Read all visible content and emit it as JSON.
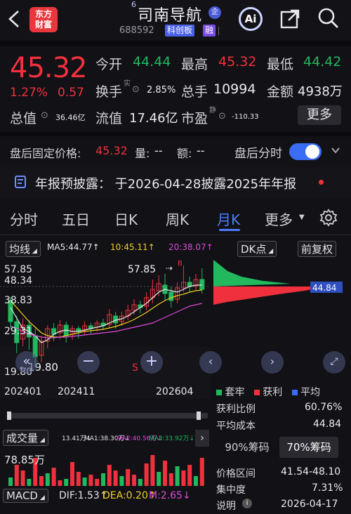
{
  "header": {
    "logo_line1": "东方",
    "logo_line2": "财富",
    "superscript": "6",
    "stock_name": "司南导航",
    "name_badge": "企",
    "stock_code": "688592",
    "tag_board": "科创板",
    "tag_margin": "融",
    "ai_label": "Ai"
  },
  "quote": {
    "price": "45.32",
    "change_pct": "1.27%",
    "change_abs": "0.57",
    "open_label": "今开",
    "open": "44.44",
    "high_label": "最高",
    "high": "45.32",
    "low_label": "最低",
    "low": "44.42",
    "turnover_label": "换手",
    "turnover_sup": "实",
    "turnover": "2.85%",
    "volume_label": "总手",
    "volume": "10994",
    "amount_label": "金额",
    "amount": "4938万",
    "mcap_label": "总值",
    "mcap": "36.46亿",
    "float_label": "流值",
    "float": "17.46亿",
    "pe_label": "市盈",
    "pe_sup": "静",
    "pe": "-110.33",
    "more_label": "更多"
  },
  "after_hours": {
    "price_label": "盘后固定价格:",
    "price": "45.32",
    "vol_label": "量:",
    "vol": "--",
    "amt_label": "额:",
    "amt": "--",
    "tick_label": "盘后分时"
  },
  "announcement": {
    "text": "年报预披露： 于2026-04-28披露2025年年报"
  },
  "tabs": [
    "分时",
    "五日",
    "日K",
    "周K",
    "月K",
    "更多"
  ],
  "chart_controls": {
    "ma_selector": "均线",
    "ma5": "MA5:44.77↑",
    "ma10": "10:45.11↑",
    "ma20": "20:38.07↑",
    "dk_label": "DK点",
    "adjust_label": "前复权"
  },
  "kline": {
    "y_ticks": [
      "57.85",
      "48.34",
      "38.83",
      "29.31",
      "19.80"
    ],
    "max_label": "57.85",
    "min_label": "19.80",
    "x_ticks": [
      "202401",
      "202411",
      "202604"
    ],
    "b_marker": "B",
    "s_marker": "S",
    "current_price_tag": "44.84"
  },
  "chip_panel": {
    "legend": [
      {
        "label": "套牢",
        "color": "#22b95e"
      },
      {
        "label": "获利",
        "color": "#f0313d"
      },
      {
        "label": "平均",
        "color": "#3a6cf5"
      }
    ],
    "profit_ratio_label": "获利比例",
    "profit_ratio": "60.76%",
    "avg_cost_label": "平均成本",
    "avg_cost": "44.84",
    "btn_90": "90%筹码",
    "btn_70": "70%筹码",
    "range_label": "价格区间",
    "range": "41.54-48.10",
    "concentration_label": "集中度",
    "concentration": "7.31%",
    "note_label": "说明",
    "note_date": "2026-04-17"
  },
  "volume": {
    "selector": "成交量",
    "vol": "13.41万↓",
    "ma1": "MA1:38.30万↓",
    "ma2": "MA2:40.56万↓",
    "ma3": "MA3:33.92万↓",
    "y_top": "78.85万"
  },
  "macd": {
    "selector": "MACD",
    "dif": "DIF:1.53↑",
    "dea": "DEA:0.20↑",
    "m": "M:2.65↓"
  },
  "colors": {
    "up": "#f0313d",
    "down": "#22b95e",
    "accent": "#4d7cff"
  }
}
